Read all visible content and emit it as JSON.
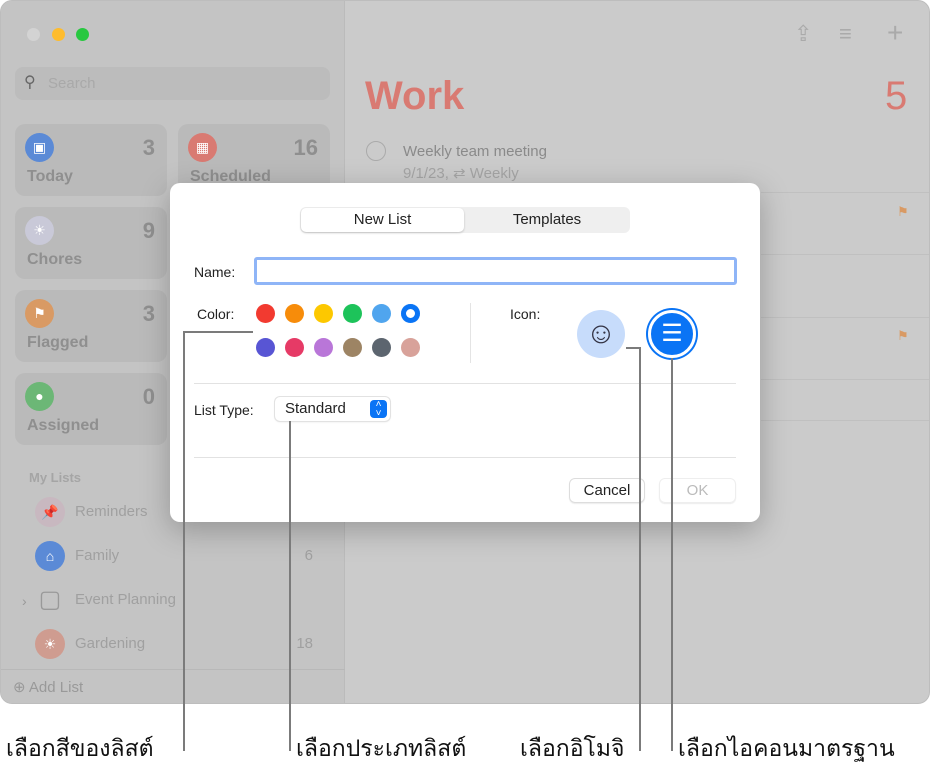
{
  "sidebar": {
    "search_placeholder": "Search",
    "smart_lists": [
      {
        "label": "Today",
        "count": "3",
        "icon": "calendar-icon",
        "color": "#5b8ad6"
      },
      {
        "label": "Scheduled",
        "count": "16",
        "icon": "calendar-grid-icon",
        "color": "#d97a72"
      },
      {
        "label": "Chores",
        "count": "9",
        "icon": "sun-icon",
        "color": "#c9c9d8"
      },
      {
        "label": "Flagged",
        "count": "3",
        "icon": "flag-icon",
        "color": "#d99a64"
      },
      {
        "label": "Assigned",
        "count": "0",
        "icon": "person-icon",
        "color": "#6cb776"
      }
    ],
    "my_lists_header": "My Lists",
    "lists": [
      {
        "label": "Reminders",
        "count": "",
        "icon": "pin-icon",
        "color": "#c8b8c0"
      },
      {
        "label": "Family",
        "count": "6",
        "icon": "house-icon",
        "color": "#5b8ad6"
      },
      {
        "label": "Event Planning",
        "count": "",
        "icon": "folder-icon",
        "color": "transparent"
      },
      {
        "label": "Gardening",
        "count": "18",
        "icon": "sun-icon",
        "color": "#cf9c90"
      }
    ],
    "add_list": "Add List"
  },
  "main": {
    "title": "Work",
    "count": "5",
    "task": {
      "title": "Weekly team meeting",
      "date": "9/1/23,",
      "repeat": "Weekly"
    },
    "accent": "#d97a72"
  },
  "dialog": {
    "tabs": [
      "New List",
      "Templates"
    ],
    "name_label": "Name:",
    "name_value": "",
    "color_label": "Color:",
    "colors": [
      "#f23a30",
      "#f78c0a",
      "#fdc800",
      "#1dc35a",
      "#50a5ee",
      "#0a74f5",
      "#5855d4",
      "#e63a66",
      "#b976d8",
      "#9d8464",
      "#5c656f",
      "#d8a29a"
    ],
    "selected_color": "#0a74f5",
    "icon_label": "Icon:",
    "icons": [
      "smiley-icon",
      "list-bullet-icon"
    ],
    "list_type_label": "List Type:",
    "list_type_value": "Standard",
    "cancel": "Cancel",
    "ok": "OK"
  },
  "callouts": [
    "เลือกสีของลิสต์",
    "เลือกประเภทลิสต์",
    "เลือกอิโมจิ",
    "เลือกไอคอนมาตรฐาน"
  ]
}
